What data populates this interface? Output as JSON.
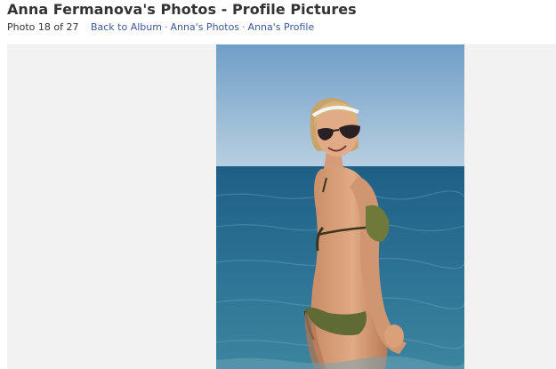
{
  "header": {
    "title": "Anna Fermanova's Photos - Profile Pictures"
  },
  "nav": {
    "photo_count": "Photo 18 of 27",
    "links": [
      "Back to Album",
      "Anna's Photos",
      "Anna's Profile"
    ],
    "separator": "·"
  },
  "colors": {
    "link": "#3b5998",
    "title": "#333333",
    "stage_background": "#f2f2f2",
    "sky": "#8fb2cf",
    "sea": "#2f6f8e"
  }
}
